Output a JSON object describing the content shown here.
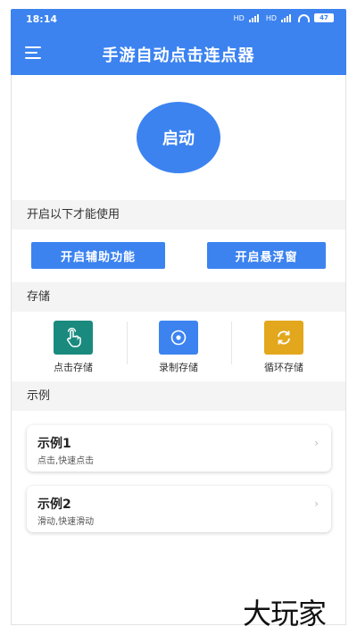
{
  "status_bar": {
    "time": "18:14",
    "battery": "47",
    "signal1": "HD",
    "signal2": "HD"
  },
  "header": {
    "title": "手游自动点击连点器",
    "menu_icon": "menu-icon"
  },
  "start_button": {
    "label": "启动"
  },
  "permissions": {
    "heading": "开启以下才能使用",
    "accessibility_button": "开启辅助功能",
    "overlay_button": "开启悬浮窗"
  },
  "storage": {
    "heading": "存储",
    "items": [
      {
        "label": "点击存储",
        "icon": "tap-hand-icon",
        "color": "#1a8a7e"
      },
      {
        "label": "录制存储",
        "icon": "record-icon",
        "color": "#3c83f0"
      },
      {
        "label": "循环存储",
        "icon": "loop-icon",
        "color": "#e2a71c"
      }
    ]
  },
  "examples": {
    "heading": "示例",
    "items": [
      {
        "title": "示例1",
        "subtitle": "点击,快速点击"
      },
      {
        "title": "示例2",
        "subtitle": "滑动,快速滑动"
      }
    ]
  },
  "watermark": "大玩家",
  "colors": {
    "primary": "#3c83f0",
    "section_bg": "#f4f4f4"
  }
}
